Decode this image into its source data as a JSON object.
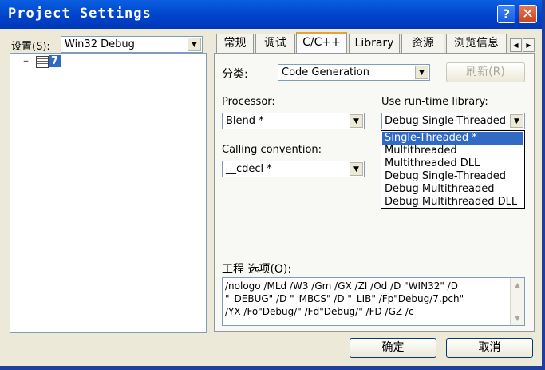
{
  "window": {
    "title": "Project Settings",
    "help_glyph": "?",
    "close_glyph": "✕"
  },
  "settings": {
    "label": "设置(S):",
    "value": "Win32 Debug"
  },
  "tree": {
    "expand_glyph": "+",
    "item_label": "7"
  },
  "tabs": [
    "常规",
    "调试",
    "C/C++",
    "Library",
    "资源",
    "浏览信息"
  ],
  "active_tab": "C/C++",
  "category": {
    "label": "分类:",
    "value": "Code Generation",
    "reset_label": "刷新(R)"
  },
  "processor": {
    "label": "Processor:",
    "value": "Blend *"
  },
  "runtime": {
    "label": "Use run-time library:",
    "value": "Debug Single-Threaded",
    "options": [
      "Single-Threaded *",
      "Multithreaded",
      "Multithreaded DLL",
      "Debug Single-Threaded",
      "Debug Multithreaded",
      "Debug Multithreaded DLL"
    ],
    "selected_index": 0
  },
  "calling": {
    "label": "Calling convention:",
    "value": "__cdecl *"
  },
  "options_box": {
    "label": "工程 选项(O):",
    "lines": [
      "/nologo /MLd /W3 /Gm /GX /ZI /Od /D \"WIN32\" /D",
      "\"_DEBUG\" /D \"_MBCS\" /D \"_LIB\" /Fp\"Debug/7.pch\"",
      "/YX /Fo\"Debug/\" /Fd\"Debug/\" /FD /GZ /c"
    ]
  },
  "buttons": {
    "ok": "确定",
    "cancel": "取消"
  },
  "icons": {
    "dropdown_arrow": "▼",
    "scroll_left": "◀",
    "scroll_right": "▶",
    "scroll_up": "▲",
    "scroll_down": "▼"
  },
  "colors": {
    "titlebar": "#0a5fe0",
    "selection": "#316ac5",
    "dialog": "#ece9d8"
  }
}
